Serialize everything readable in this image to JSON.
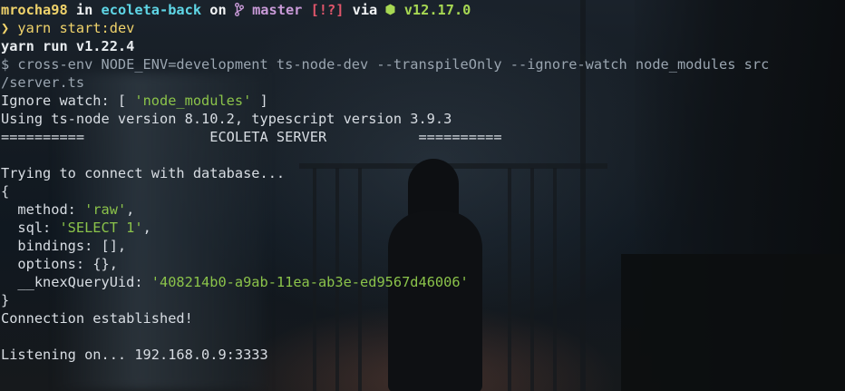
{
  "prompt": {
    "user": "mrocha98",
    "in_text": " in ",
    "directory": "ecoleta-back",
    "on_text": " on ",
    "branch_icon": "git-branch-icon",
    "branch": " master",
    "git_status": " [!?]",
    "via_text": " via ",
    "node_icon": "nodejs-hexagon-icon",
    "node_version": " v12.17.0",
    "arrow_icon": "prompt-chevron-icon",
    "command": " yarn start:dev"
  },
  "output": {
    "yarn_run": "yarn run v1.22.4",
    "script_line1": "$ cross-env NODE_ENV=development ts-node-dev --transpileOnly --ignore-watch node_modules src",
    "script_line2": "/server.ts",
    "ignore_watch_prefix": "Ignore watch: [ ",
    "ignore_watch_value": "'node_modules'",
    "ignore_watch_suffix": " ]",
    "ts_node": "Using ts-node version 8.10.2, typescript version 3.9.3",
    "banner": "==========               ECOLETA SERVER           ==========",
    "blank": "",
    "trying": "Trying to connect with database...",
    "open_brace": "{",
    "method_key": "  method: ",
    "method_val": "'raw'",
    "method_comma": ",",
    "sql_key": "  sql: ",
    "sql_val": "'SELECT 1'",
    "sql_comma": ",",
    "bindings": "  bindings: [],",
    "options": "  options: {},",
    "uid_key": "  __knexQueryUid: ",
    "uid_val": "'408214b0-a9ab-11ea-ab3e-ed9567d46006'",
    "close_brace": "}",
    "established": "Connection established!",
    "listening": "Listening on... 192.168.0.9:3333"
  },
  "colors": {
    "user": "#f0d36b",
    "directory": "#5fd6e6",
    "git": "#c99ad8",
    "status": "#e0566b",
    "node": "#a7d853",
    "string": "#8bc34a"
  }
}
